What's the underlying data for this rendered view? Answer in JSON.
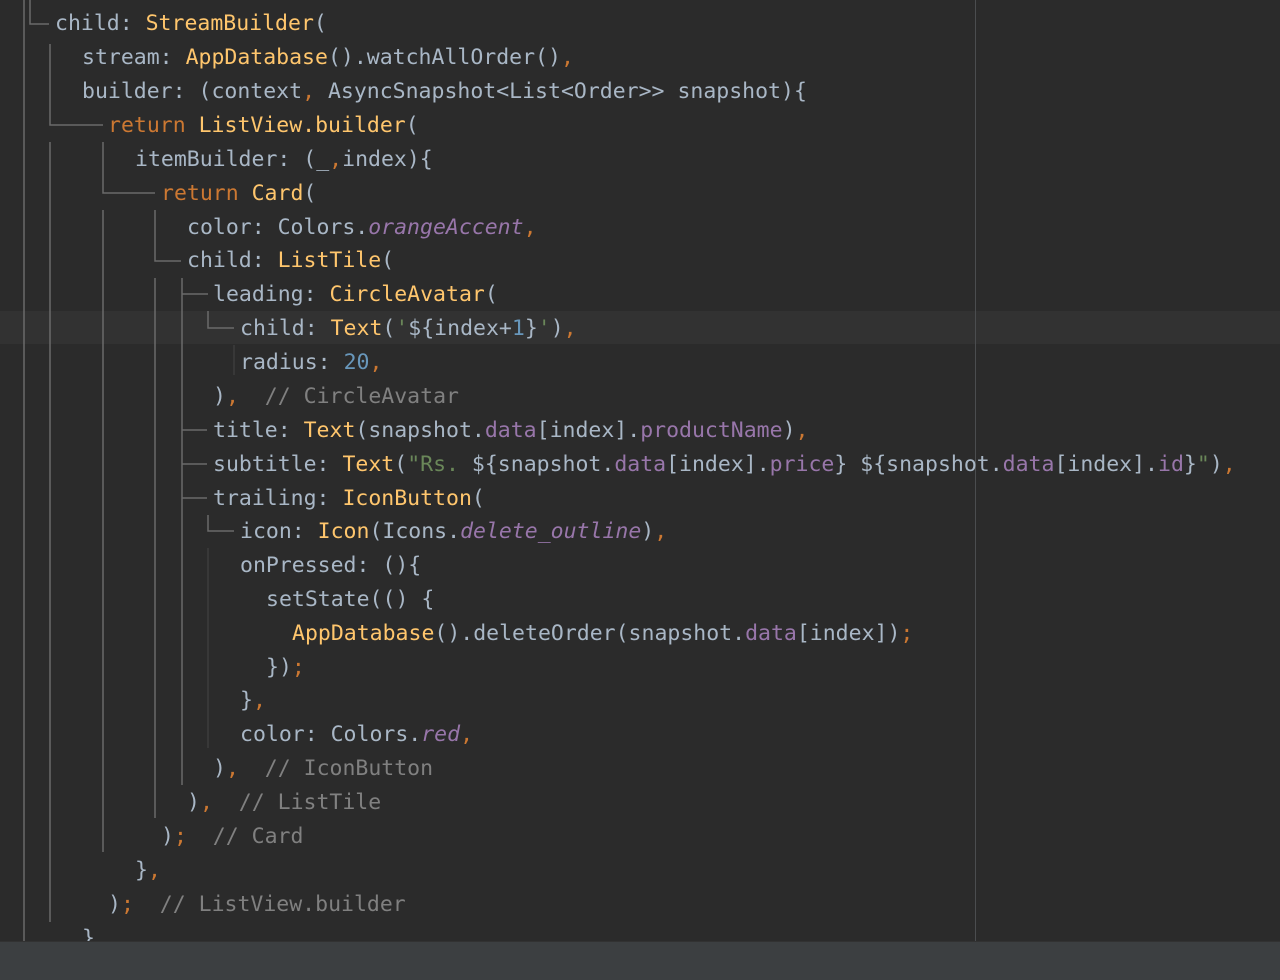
{
  "editor": {
    "colors": {
      "background": "#2b2b2b",
      "current_line": "#323232",
      "default": "#a9b7c6",
      "keyword": "#cc7832",
      "class_name": "#ffc66d",
      "string": "#6a8759",
      "number": "#6897bb",
      "property": "#9876aa",
      "comment": "#808080",
      "status_bar": "#3c3f41"
    },
    "lines": [
      [
        {
          "t": "t-plain",
          "s": "child: "
        },
        {
          "t": "t-cls",
          "s": "StreamBuilder"
        },
        {
          "t": "t-plain",
          "s": "("
        }
      ],
      [
        {
          "t": "t-plain",
          "s": "stream: "
        },
        {
          "t": "t-cls",
          "s": "AppDatabase"
        },
        {
          "t": "t-plain",
          "s": "().watchAllOrder()"
        },
        {
          "t": "t-kw",
          "s": ","
        }
      ],
      [
        {
          "t": "t-plain",
          "s": "builder: (context"
        },
        {
          "t": "t-kw",
          "s": ", "
        },
        {
          "t": "t-plain",
          "s": "AsyncSnapshot<List<Order>> snapshot){"
        }
      ],
      [
        {
          "t": "t-kw",
          "s": "return "
        },
        {
          "t": "t-cls",
          "s": "ListView.builder"
        },
        {
          "t": "t-plain",
          "s": "("
        }
      ],
      [
        {
          "t": "t-plain",
          "s": "itemBuilder: (_"
        },
        {
          "t": "t-kw",
          "s": ","
        },
        {
          "t": "t-plain",
          "s": "index){"
        }
      ],
      [
        {
          "t": "t-kw",
          "s": "return "
        },
        {
          "t": "t-cls",
          "s": "Card"
        },
        {
          "t": "t-plain",
          "s": "("
        }
      ],
      [
        {
          "t": "t-plain",
          "s": "color: Colors."
        },
        {
          "t": "t-const",
          "s": "orangeAccent"
        },
        {
          "t": "t-kw",
          "s": ","
        }
      ],
      [
        {
          "t": "t-plain",
          "s": "child: "
        },
        {
          "t": "t-cls",
          "s": "ListTile"
        },
        {
          "t": "t-plain",
          "s": "("
        }
      ],
      [
        {
          "t": "t-plain",
          "s": "leading: "
        },
        {
          "t": "t-cls",
          "s": "CircleAvatar"
        },
        {
          "t": "t-plain",
          "s": "("
        }
      ],
      [
        {
          "t": "t-plain",
          "s": "child: "
        },
        {
          "t": "t-cls",
          "s": "Text"
        },
        {
          "t": "t-plain",
          "s": "("
        },
        {
          "t": "t-str",
          "s": "'"
        },
        {
          "t": "t-plain",
          "s": "${index+"
        },
        {
          "t": "t-num",
          "s": "1"
        },
        {
          "t": "t-plain",
          "s": "}"
        },
        {
          "t": "t-str",
          "s": "'"
        },
        {
          "t": "t-plain",
          "s": ")"
        },
        {
          "t": "t-kw",
          "s": ","
        }
      ],
      [
        {
          "t": "t-plain",
          "s": "radius: "
        },
        {
          "t": "t-num",
          "s": "20"
        },
        {
          "t": "t-kw",
          "s": ","
        }
      ],
      [
        {
          "t": "t-plain",
          "s": ")"
        },
        {
          "t": "t-kw",
          "s": ","
        },
        {
          "t": "t-cmt",
          "s": "  // CircleAvatar"
        }
      ],
      [
        {
          "t": "t-plain",
          "s": "title: "
        },
        {
          "t": "t-cls",
          "s": "Text"
        },
        {
          "t": "t-plain",
          "s": "(snapshot."
        },
        {
          "t": "t-prop",
          "s": "data"
        },
        {
          "t": "t-plain",
          "s": "[index]."
        },
        {
          "t": "t-prop",
          "s": "productName"
        },
        {
          "t": "t-plain",
          "s": ")"
        },
        {
          "t": "t-kw",
          "s": ","
        }
      ],
      [
        {
          "t": "t-plain",
          "s": "subtitle: "
        },
        {
          "t": "t-cls",
          "s": "Text"
        },
        {
          "t": "t-plain",
          "s": "("
        },
        {
          "t": "t-str",
          "s": "\"Rs. "
        },
        {
          "t": "t-plain",
          "s": "${snapshot."
        },
        {
          "t": "t-prop",
          "s": "data"
        },
        {
          "t": "t-plain",
          "s": "[index]."
        },
        {
          "t": "t-prop",
          "s": "price"
        },
        {
          "t": "t-plain",
          "s": "} ${snapshot."
        },
        {
          "t": "t-prop",
          "s": "data"
        },
        {
          "t": "t-plain",
          "s": "[index]."
        },
        {
          "t": "t-prop",
          "s": "id"
        },
        {
          "t": "t-plain",
          "s": "}"
        },
        {
          "t": "t-str",
          "s": "\""
        },
        {
          "t": "t-plain",
          "s": ")"
        },
        {
          "t": "t-kw",
          "s": ","
        }
      ],
      [
        {
          "t": "t-plain",
          "s": "trailing: "
        },
        {
          "t": "t-cls",
          "s": "IconButton"
        },
        {
          "t": "t-plain",
          "s": "("
        }
      ],
      [
        {
          "t": "t-plain",
          "s": "icon: "
        },
        {
          "t": "t-cls",
          "s": "Icon"
        },
        {
          "t": "t-plain",
          "s": "(Icons."
        },
        {
          "t": "t-const",
          "s": "delete_outline"
        },
        {
          "t": "t-plain",
          "s": ")"
        },
        {
          "t": "t-kw",
          "s": ","
        }
      ],
      [
        {
          "t": "t-plain",
          "s": "onPressed: (){"
        }
      ],
      [
        {
          "t": "t-plain",
          "s": "setState(() {"
        }
      ],
      [
        {
          "t": "t-cls",
          "s": "AppDatabase"
        },
        {
          "t": "t-plain",
          "s": "().deleteOrder(snapshot."
        },
        {
          "t": "t-prop",
          "s": "data"
        },
        {
          "t": "t-plain",
          "s": "[index])"
        },
        {
          "t": "t-kw",
          "s": ";"
        }
      ],
      [
        {
          "t": "t-plain",
          "s": "})"
        },
        {
          "t": "t-kw",
          "s": ";"
        }
      ],
      [
        {
          "t": "t-plain",
          "s": "}"
        },
        {
          "t": "t-kw",
          "s": ","
        }
      ],
      [
        {
          "t": "t-plain",
          "s": "color: Colors."
        },
        {
          "t": "t-const",
          "s": "red"
        },
        {
          "t": "t-kw",
          "s": ","
        }
      ],
      [
        {
          "t": "t-plain",
          "s": ")"
        },
        {
          "t": "t-kw",
          "s": ","
        },
        {
          "t": "t-cmt",
          "s": "  // IconButton"
        }
      ],
      [
        {
          "t": "t-plain",
          "s": ")"
        },
        {
          "t": "t-kw",
          "s": ","
        },
        {
          "t": "t-cmt",
          "s": "  // ListTile"
        }
      ],
      [
        {
          "t": "t-plain",
          "s": ")"
        },
        {
          "t": "t-kw",
          "s": ";"
        },
        {
          "t": "t-cmt",
          "s": "  // Card"
        }
      ],
      [
        {
          "t": "t-plain",
          "s": "}"
        },
        {
          "t": "t-kw",
          "s": ","
        }
      ],
      [
        {
          "t": "t-plain",
          "s": ")"
        },
        {
          "t": "t-kw",
          "s": ";"
        },
        {
          "t": "t-cmt",
          "s": "  // ListView.builder"
        }
      ],
      [
        {
          "t": "t-plain",
          "s": "}"
        }
      ]
    ]
  }
}
